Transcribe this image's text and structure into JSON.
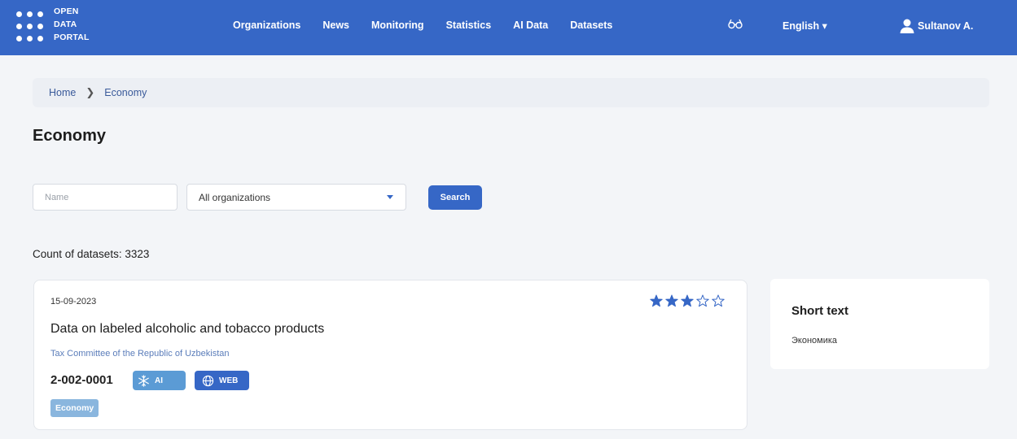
{
  "header": {
    "logo_lines": [
      "OPEN",
      "DATA",
      "PORTAL"
    ],
    "nav": [
      "Organizations",
      "News",
      "Monitoring",
      "Statistics",
      "AI Data",
      "Datasets"
    ],
    "glasses_icon": "glasses-icon",
    "language": "English",
    "language_caret": "▾",
    "user": "Sultanov A.",
    "brand_color": "#3667c6"
  },
  "breadcrumb": {
    "home": "Home",
    "separator": "❯",
    "current": "Economy"
  },
  "page": {
    "title": "Economy"
  },
  "filters": {
    "name_placeholder": "Name",
    "organization_selected": "All organizations",
    "search_label": "Search"
  },
  "count_label": "Count of datasets: 3323",
  "dataset": {
    "date": "15-09-2023",
    "rating": 3,
    "rating_max": 5,
    "title": "Data on labeled alcoholic and tobacco products",
    "organization": "Tax Committee of the Republic of Uzbekistan",
    "code": "2-002-0001",
    "badge_ai": "AI",
    "badge_web": "WEB",
    "tag": "Economy",
    "star_color": "#3667c6"
  },
  "short_text": {
    "title": "Short text",
    "text": "Экономика"
  }
}
